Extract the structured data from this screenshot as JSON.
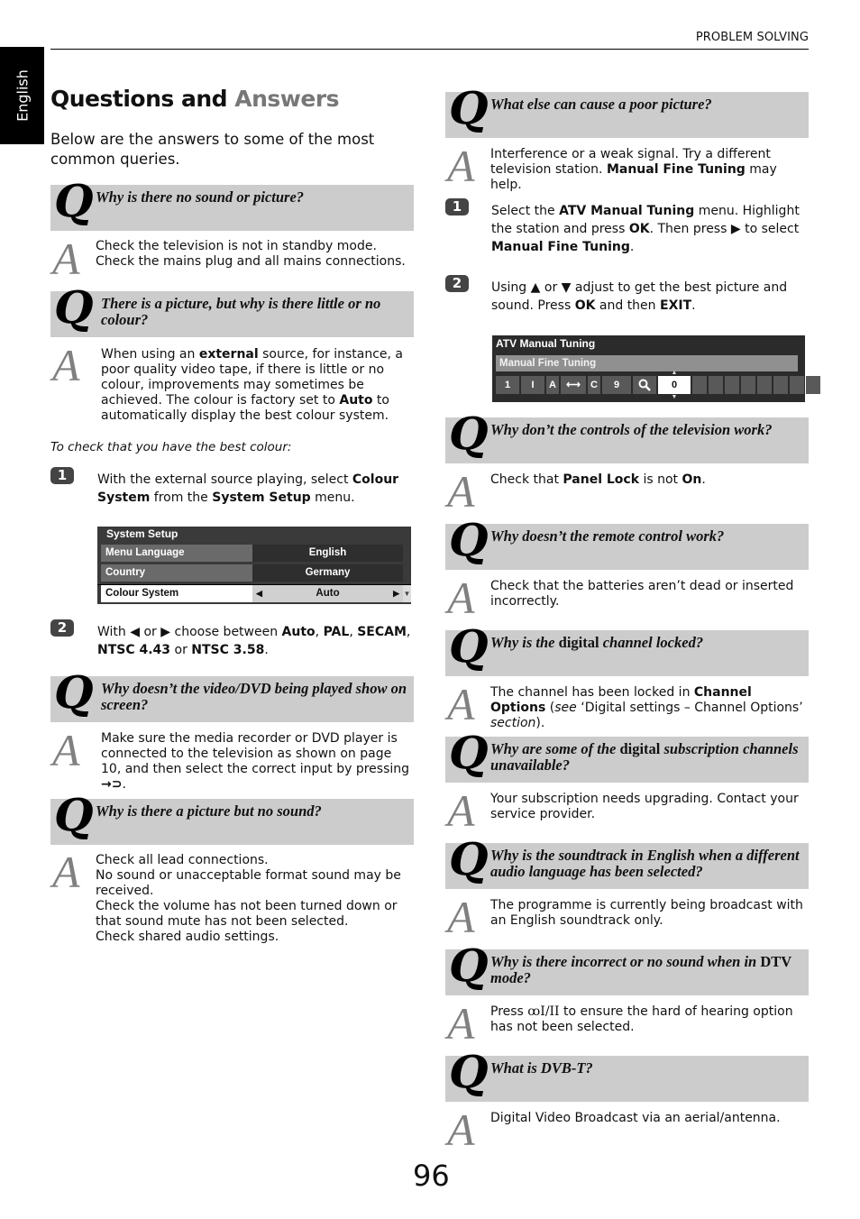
{
  "sidebar": {
    "language_tab": "English"
  },
  "header": {
    "section": "PROBLEM SOLVING"
  },
  "title": {
    "main": "Questions and",
    "accent": "Answers"
  },
  "intro": "Below are the answers to some of the most common queries.",
  "left": {
    "qa1": {
      "q": "Why is there no sound or picture?",
      "a": "Check the television is not in standby mode. Check the mains plug and all mains connections."
    },
    "qa2": {
      "q": "There is a picture, but why is there little or no colour?",
      "a_parts": [
        "When using an ",
        "external",
        " source, for instance, a poor quality video tape, if there is little or no colour, improvements may sometimes be achieved. The colour is factory set to ",
        "Auto",
        " to automatically display the best colour system."
      ]
    },
    "note": "To check that you have the best colour:",
    "step1": {
      "num": "1",
      "parts": [
        "With the external source playing, select ",
        "Colour System",
        " from the ",
        "System Setup",
        " menu."
      ]
    },
    "system_setup_menu": {
      "title": "System Setup",
      "rows": [
        {
          "label": "Menu Language",
          "value": "English"
        },
        {
          "label": "Country",
          "value": "Germany"
        },
        {
          "label": "Colour System",
          "value": "Auto",
          "selected": true
        }
      ],
      "arrow_left": "◀",
      "arrow_right": "▶",
      "scroll_indicator": "▼"
    },
    "step2": {
      "num": "2",
      "parts": [
        "With ",
        "◀",
        " or ",
        "▶",
        " choose between ",
        "Auto",
        ", ",
        "PAL",
        ", ",
        "SECAM",
        ", ",
        "NTSC 4.43",
        " or ",
        "NTSC 3.58",
        "."
      ]
    },
    "qa3": {
      "q": "Why doesn’t the video/DVD being played show on screen?",
      "a": "Make sure the media recorder or DVD player is connected to the television as shown on page 10, and then select the correct input by pressing",
      "a_icon": "input-source-icon"
    },
    "qa4": {
      "q": "Why is there a picture but no sound?",
      "a_lines": [
        "Check all lead connections.",
        "No sound or unacceptable format sound may be received.",
        "Check the volume has not been turned down or that sound mute has not been selected.",
        "Check shared audio settings."
      ]
    }
  },
  "right": {
    "qa5": {
      "q": "What else can cause a poor picture?",
      "a_parts": [
        "Interference or a weak signal. Try a different television station. ",
        "Manual Fine Tuning",
        " may help."
      ]
    },
    "step1": {
      "num": "1",
      "parts": [
        "Select the ",
        "ATV Manual Tuning",
        " menu. Highlight the station and press ",
        "OK",
        ". Then press ",
        "▶",
        " to select ",
        "Manual Fine Tuning",
        "."
      ]
    },
    "step2": {
      "num": "2",
      "parts": [
        "Using ",
        "▲",
        " or ",
        "▼",
        " adjust to get the best picture and sound. Press ",
        "OK",
        " and then ",
        "EXIT",
        "."
      ]
    },
    "atv_menu": {
      "title": "ATV Manual Tuning",
      "subtitle": "Manual Fine Tuning",
      "cells": [
        "1",
        "I",
        "A",
        "⟷",
        "C",
        "9",
        "search-icon",
        "0"
      ],
      "active_value": "0",
      "empty_cells": 8
    },
    "qa6": {
      "q": "Why don’t the controls of the television work?",
      "a_parts": [
        "Check that ",
        "Panel Lock",
        " is not ",
        "On",
        "."
      ]
    },
    "qa7": {
      "q": "Why doesn’t the remote control work?",
      "a": "Check that the batteries aren’t dead or inserted incorrectly."
    },
    "qa8": {
      "q_parts": [
        "Why is the ",
        "digital",
        " channel locked?"
      ],
      "a_parts": [
        "The channel has been locked in ",
        "Channel Options",
        " (",
        "see",
        " ‘Digital settings – Channel Options’ ",
        "section",
        ")."
      ]
    },
    "qa9": {
      "q_parts": [
        "Why are some of the ",
        "digital",
        " subscription channels unavailable?"
      ],
      "a": "Your subscription needs upgrading. Contact your service provider."
    },
    "qa10": {
      "q": "Why is the soundtrack in English when a different audio language has been selected?",
      "a": "The programme is currently being broadcast with an English soundtrack only."
    },
    "qa11": {
      "q_parts": [
        "Why is there incorrect or no sound when in ",
        "DTV",
        " mode?"
      ],
      "a_parts": [
        "Press ",
        "ꝏI/II",
        " to ensure the hard of hearing option has not been selected."
      ]
    },
    "qa12": {
      "q": "What is DVB-T?",
      "a": "Digital Video Broadcast via an aerial/antenna."
    }
  },
  "letters": {
    "q": "Q",
    "a": "A"
  },
  "page_number": "96",
  "colors": {
    "q_box_bg": "#cccccc",
    "a_letter": "#808080",
    "accent_title": "#777777",
    "menu_dark": "#2b2b2b"
  }
}
